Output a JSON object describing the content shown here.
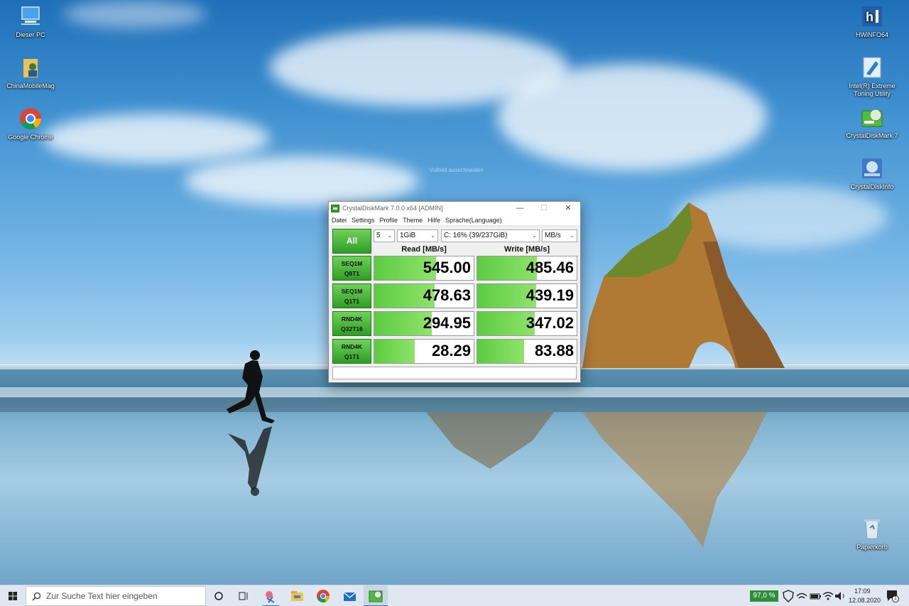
{
  "desktop": {
    "icons_left": [
      {
        "label": "Dieser PC",
        "icon": "computer-icon"
      },
      {
        "label": "ChinaMobileMag",
        "icon": "user-folder-icon"
      },
      {
        "label": "Google Chrome",
        "icon": "chrome-icon"
      }
    ],
    "icons_right": [
      {
        "label": "HWiNFO64",
        "icon": "hwinfo-icon"
      },
      {
        "label": "Intel(R) Extreme Tuning Utility",
        "icon": "intel-xtu-icon"
      },
      {
        "label": "CrystalDiskMark 7",
        "icon": "crystaldiskmark-icon"
      },
      {
        "label": "CrystalDiskInfo",
        "icon": "crystaldiskinfo-icon"
      }
    ],
    "recycle_bin": {
      "label": "Papierkorb",
      "icon": "recycle-bin-icon"
    },
    "ghost_text": "Vollbild ausschneiden"
  },
  "window": {
    "title": "CrystalDiskMark 7.0.0 x64 [ADMIN]",
    "controls": {
      "minimize": "—",
      "maximize": "☐",
      "close": "✕"
    },
    "menu": [
      "Datei",
      "Settings",
      "Profile",
      "Theme",
      "Hilfe",
      "Sprache(Language)"
    ],
    "all_button": "All",
    "selects": {
      "count": "5",
      "size": "1GiB",
      "drive": "C: 16% (39/237GiB)",
      "unit": "MB/s"
    },
    "headers": {
      "read": "Read [MB/s]",
      "write": "Write [MB/s]"
    },
    "tests": [
      {
        "line1": "SEQ1M",
        "line2": "Q8T1",
        "read": "545.00",
        "write": "485.46",
        "read_fill": 0.62,
        "write_fill": 0.6
      },
      {
        "line1": "SEQ1M",
        "line2": "Q1T1",
        "read": "478.63",
        "write": "439.19",
        "read_fill": 0.61,
        "write_fill": 0.59
      },
      {
        "line1": "RND4K",
        "line2": "Q32T16",
        "read": "294.95",
        "write": "347.02",
        "read_fill": 0.58,
        "write_fill": 0.58
      },
      {
        "line1": "RND4K",
        "line2": "Q1T1",
        "read": "28.29",
        "write": "83.88",
        "read_fill": 0.41,
        "write_fill": 0.47
      }
    ],
    "comment": ""
  },
  "taskbar": {
    "search_placeholder": "Zur Suche Text hier eingeben",
    "battery": "97,0 %",
    "time": "17:09",
    "date": "12.08.2020",
    "notification_count": "1"
  },
  "colors": {
    "bar_green": "#5ccc41",
    "button_green": "#2f9d25",
    "taskbar": "#dfe8f1"
  }
}
